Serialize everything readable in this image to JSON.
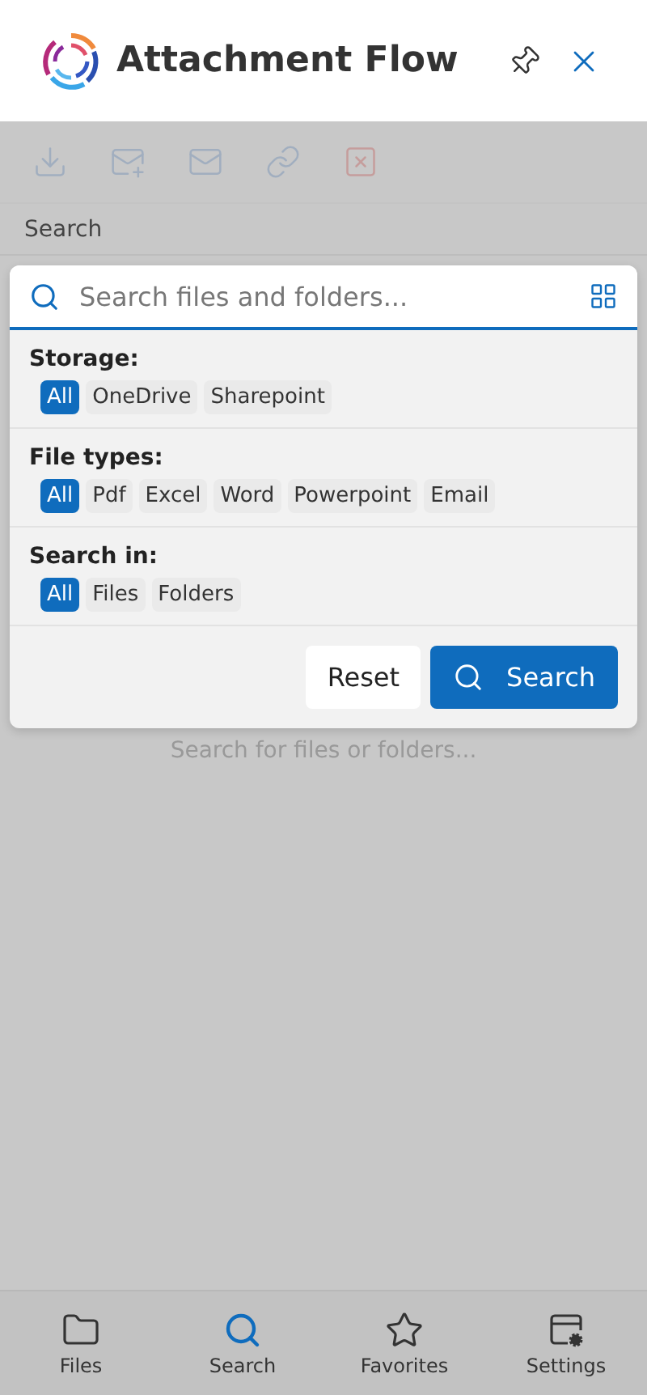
{
  "header": {
    "title": "Attachment Flow"
  },
  "toolbar": {
    "disabled": true
  },
  "section_label": "Search",
  "search": {
    "placeholder": "Search files and folders..."
  },
  "filters": [
    {
      "label": "Storage:",
      "options": [
        {
          "label": "All",
          "selected": true
        },
        {
          "label": "OneDrive",
          "selected": false
        },
        {
          "label": "Sharepoint",
          "selected": false
        }
      ]
    },
    {
      "label": "File types:",
      "options": [
        {
          "label": "All",
          "selected": true
        },
        {
          "label": "Pdf",
          "selected": false
        },
        {
          "label": "Excel",
          "selected": false
        },
        {
          "label": "Word",
          "selected": false
        },
        {
          "label": "Powerpoint",
          "selected": false
        },
        {
          "label": "Email",
          "selected": false
        }
      ]
    },
    {
      "label": "Search in:",
      "options": [
        {
          "label": "All",
          "selected": true
        },
        {
          "label": "Files",
          "selected": false
        },
        {
          "label": "Folders",
          "selected": false
        }
      ]
    }
  ],
  "buttons": {
    "reset": "Reset",
    "search": "Search"
  },
  "empty_text": "Search for files or folders...",
  "nav": [
    {
      "kind": "files",
      "label": "Files",
      "selected": false
    },
    {
      "kind": "search",
      "label": "Search",
      "selected": true
    },
    {
      "kind": "favorites",
      "label": "Favorites",
      "selected": false
    },
    {
      "kind": "settings",
      "label": "Settings",
      "selected": false
    }
  ]
}
